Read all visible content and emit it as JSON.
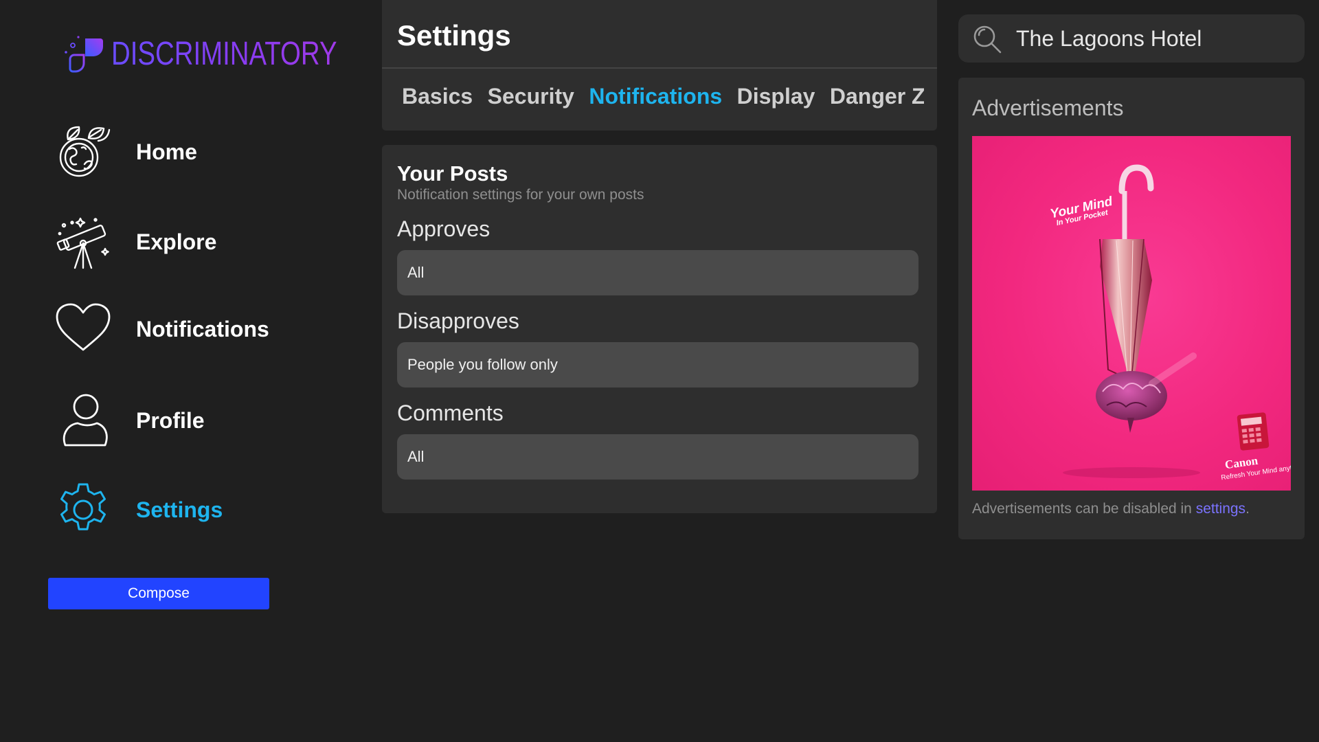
{
  "brand": {
    "name": "DISCRIMINATORY"
  },
  "sidebar": {
    "items": [
      {
        "label": "Home",
        "icon": "globe-leaf-icon"
      },
      {
        "label": "Explore",
        "icon": "telescope-icon"
      },
      {
        "label": "Notifications",
        "icon": "heart-icon"
      },
      {
        "label": "Profile",
        "icon": "person-icon"
      },
      {
        "label": "Settings",
        "icon": "gear-icon",
        "active": true
      }
    ],
    "compose_label": "Compose"
  },
  "settings": {
    "title": "Settings",
    "tabs": [
      {
        "label": "Basics"
      },
      {
        "label": "Security"
      },
      {
        "label": "Notifications",
        "active": true
      },
      {
        "label": "Display"
      },
      {
        "label": "Danger Zone"
      }
    ]
  },
  "your_posts": {
    "title": "Your Posts",
    "subtitle": "Notification settings for your own posts",
    "fields": [
      {
        "label": "Approves",
        "value": "All"
      },
      {
        "label": "Disapproves",
        "value": "People you follow only"
      },
      {
        "label": "Comments",
        "value": "All"
      }
    ]
  },
  "search": {
    "value": "The Lagoons Hotel"
  },
  "ads": {
    "title": "Advertisements",
    "image": {
      "tagline_line1": "Your Mind",
      "tagline_line2": "In Your Pocket",
      "brand": "Canon",
      "slogan_line1": "Refresh Your Mind",
      "slogan_line2": "anytime"
    },
    "note_prefix": "Advertisements can be disabled in ",
    "note_link": "settings",
    "note_suffix": "."
  },
  "colors": {
    "accent": "#1eb4ee",
    "compose": "#2244ff",
    "link": "#7b73ff",
    "ad_background": "#f2287f"
  }
}
